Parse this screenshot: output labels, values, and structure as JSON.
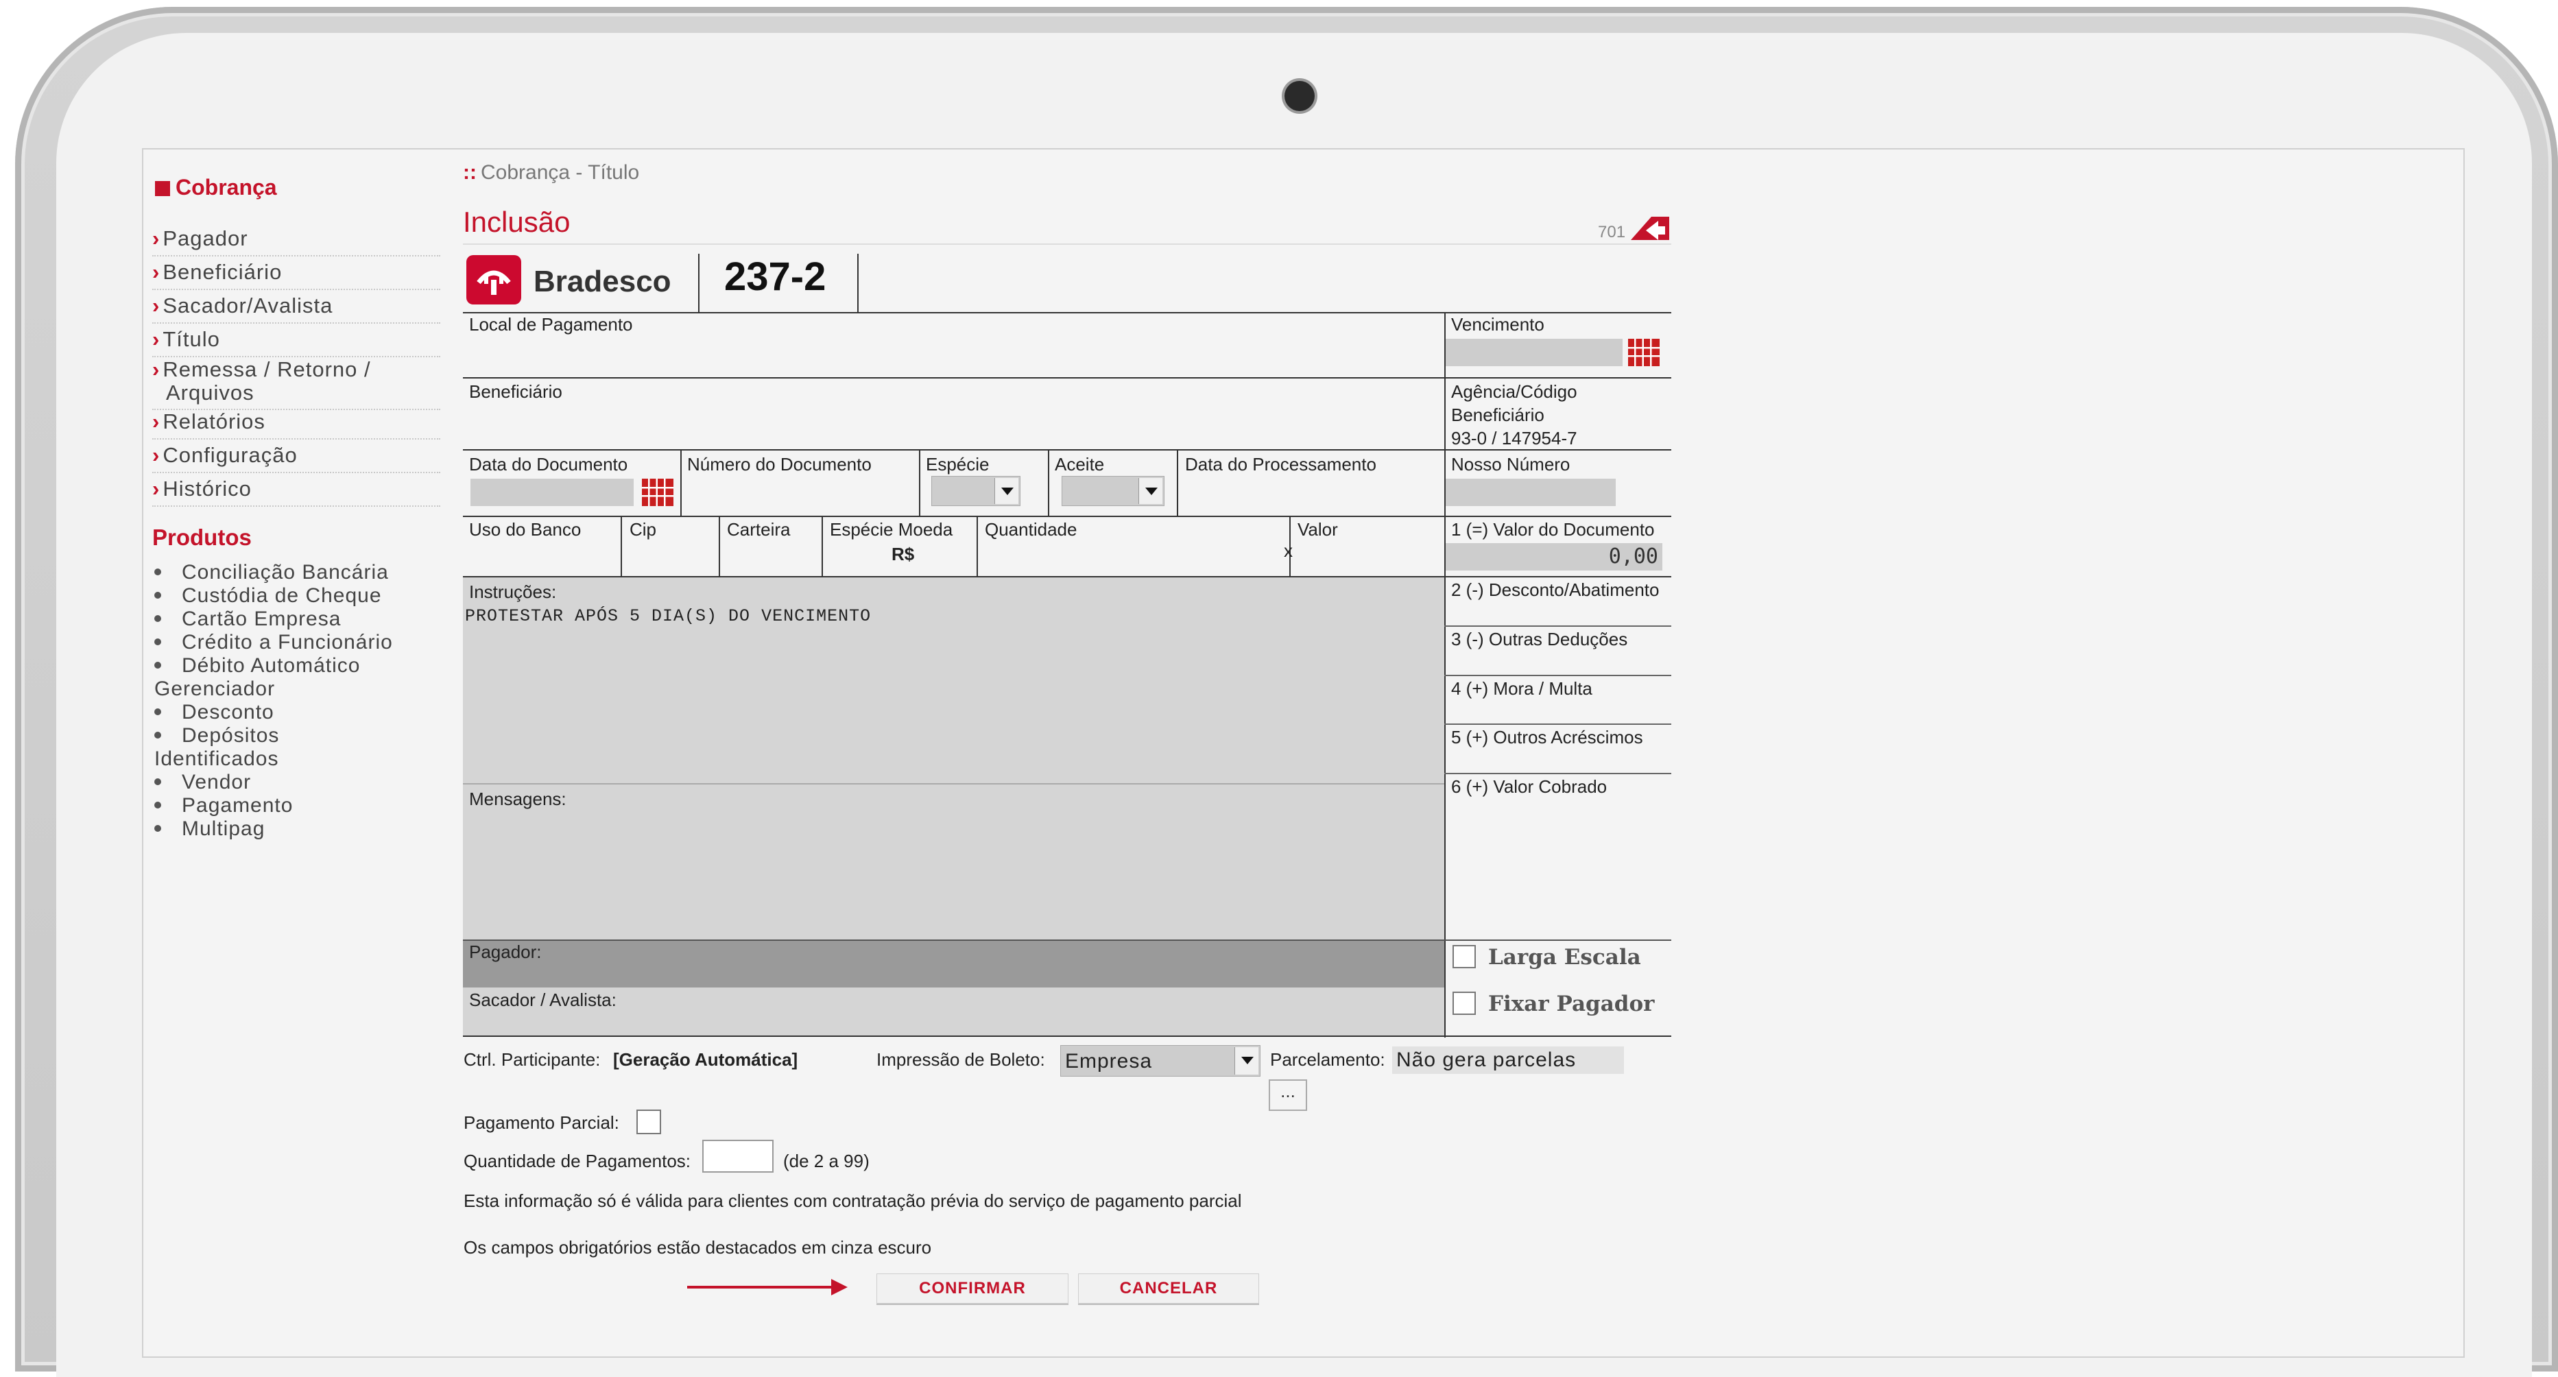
{
  "sidebar": {
    "section_title": "Cobrança",
    "items": [
      {
        "label": "Pagador"
      },
      {
        "label": "Beneficiário"
      },
      {
        "label": "Sacador/Avalista"
      },
      {
        "label": "Título"
      },
      {
        "label": "Remessa / Retorno /"
      },
      {
        "label": "Arquivos"
      },
      {
        "label": "Relatórios"
      },
      {
        "label": "Configuração"
      },
      {
        "label": "Histórico"
      }
    ],
    "products_title": "Produtos",
    "products": [
      "Conciliação Bancária",
      "Custódia de Cheque",
      "Cartão Empresa",
      "Crédito a Funcionário",
      "Débito Automático",
      "Gerenciador",
      "Desconto",
      "Depósitos",
      "Identificados",
      "Vendor",
      "Pagamento",
      "Multipag"
    ]
  },
  "header": {
    "breadcrumb": "Cobrança - Título",
    "title": "Inclusão",
    "screen_code": "701"
  },
  "bank": {
    "name": "Bradesco",
    "code": "237-2",
    "brand_color": "#cc092f"
  },
  "form": {
    "local_pagamento": "Local de Pagamento",
    "vencimento": "Vencimento",
    "beneficiario": "Beneficiário",
    "agencia_label_1": "Agência/Código",
    "agencia_label_2": "Beneficiário",
    "agencia_value": "93-0 / 147954-7",
    "data_documento": "Data do Documento",
    "numero_documento": "Número do Documento",
    "especie": "Espécie",
    "aceite": "Aceite",
    "data_processamento": "Data do Processamento",
    "nosso_numero": "Nosso Número",
    "uso_banco": "Uso do Banco",
    "cip": "Cip",
    "carteira": "Carteira",
    "especie_moeda": "Espécie Moeda",
    "especie_moeda_value": "R$",
    "quantidade": "Quantidade",
    "valor": "Valor",
    "x_mark": "x",
    "valor_documento": "1 (=) Valor do Documento",
    "valor_documento_value": "0,00",
    "desconto": "2 (-) Desconto/Abatimento",
    "outras_deducoes": "3 (-) Outras Deduções",
    "mora_multa": "4 (+) Mora / Multa",
    "outros_acrescimos": "5 (+) Outros Acréscimos",
    "valor_cobrado": "6 (+) Valor Cobrado",
    "instrucoes": "Instruções:",
    "instrucoes_value": "PROTESTAR APÓS 5 DIA(S) DO VENCIMENTO",
    "mensagens": "Mensagens:",
    "pagador": "Pagador:",
    "sacador": "Sacador / Avalista:",
    "larga_escala": "Larga Escala",
    "fixar_pagador": "Fixar Pagador"
  },
  "options": {
    "ctrl_participante_label": "Ctrl. Participante:",
    "ctrl_participante_value": "[Geração Automática]",
    "impressao_label": "Impressão de Boleto:",
    "impressao_value": "Empresa",
    "parcelamento_label": "Parcelamento:",
    "parcelamento_value": "Não gera parcelas",
    "parcelamento_button": "...",
    "pagamento_parcial_label": "Pagamento Parcial:",
    "qtd_pagamentos_label": "Quantidade de Pagamentos:",
    "qtd_pagamentos_hint": "(de 2 a 99)",
    "info_text": "Esta informação só é válida para clientes com contratação prévia do serviço de pagamento parcial",
    "obrigatorios_text": "Os campos obrigatórios estão destacados em cinza escuro"
  },
  "actions": {
    "confirm": "CONFIRMAR",
    "cancel": "CANCELAR"
  },
  "icons": {
    "calendar": "calendar-icon",
    "back": "back-arrow-icon",
    "dropdown": "chevron-down-icon",
    "pointer": "right-arrow-icon"
  }
}
